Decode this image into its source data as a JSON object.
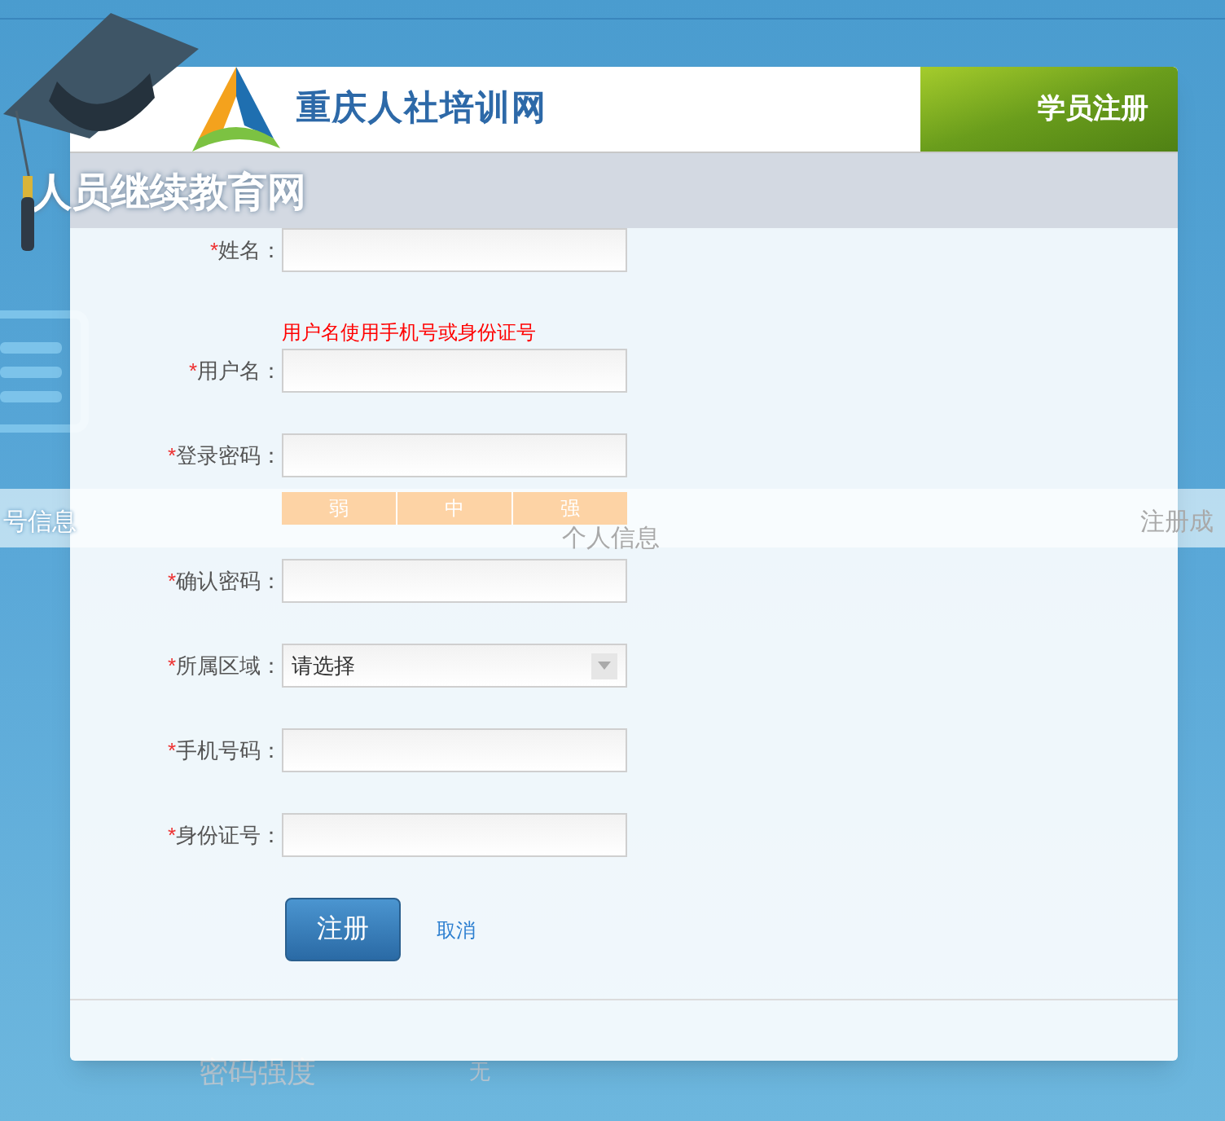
{
  "background": {
    "site_title": "人员继续教育网",
    "steps": [
      {
        "label": "号信息",
        "selected": true
      },
      {
        "label": "个人信息",
        "selected": false
      },
      {
        "label": "注册成",
        "selected": false
      }
    ],
    "strength_label": "密码强度",
    "strength_value": "无"
  },
  "dialog": {
    "site_name": "重庆人社培训网",
    "tab": "学员注册",
    "fields": [
      {
        "kind": "text",
        "label": "姓名：",
        "required_mark": "*"
      },
      {
        "kind": "text",
        "label": "用户名：",
        "required_mark": "*",
        "hint": "用户名使用手机号或身份证号"
      },
      {
        "kind": "password",
        "label": "登录密码：",
        "required_mark": "*",
        "strength": [
          "弱",
          "中",
          "强"
        ]
      },
      {
        "kind": "password",
        "label": "确认密码：",
        "required_mark": "*"
      },
      {
        "kind": "select",
        "label": "所属区域：",
        "required_mark": "*",
        "value": "请选择"
      },
      {
        "kind": "text",
        "label": "手机号码：",
        "required_mark": "*"
      },
      {
        "kind": "text",
        "label": "身份证号：",
        "required_mark": "*"
      }
    ],
    "submit": "注册",
    "cancel": "取消"
  }
}
